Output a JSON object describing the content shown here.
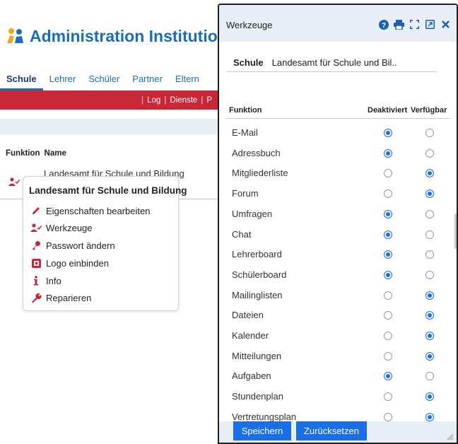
{
  "app": {
    "title": "Administration Institution"
  },
  "nav": {
    "tabs": [
      "Schule",
      "Lehrer",
      "Schüler",
      "Partner",
      "Eltern"
    ]
  },
  "subnav": {
    "items": [
      "Log",
      "Dienste",
      "P"
    ]
  },
  "table": {
    "headers": [
      "Funktion",
      "Name"
    ],
    "row_name": "Landesamt für Schule und Bildung"
  },
  "context_menu": {
    "title": "Landesamt für Schule und Bildung",
    "items": [
      {
        "label": "Eigenschaften bearbeiten",
        "icon": "pencil-icon"
      },
      {
        "label": "Werkzeuge",
        "icon": "user-check-icon"
      },
      {
        "label": "Passwort ändern",
        "icon": "key-icon"
      },
      {
        "label": "Logo einbinden",
        "icon": "image-icon"
      },
      {
        "label": "Info",
        "icon": "info-icon"
      },
      {
        "label": "Reparieren",
        "icon": "wrench-icon"
      }
    ]
  },
  "panel": {
    "title": "Werkzeuge",
    "header_icons": [
      "help-icon",
      "print-icon",
      "expand-icon",
      "external-link-icon",
      "close-icon"
    ],
    "school_label": "Schule",
    "school_value": "Landesamt für Schule und Bil..",
    "columns": [
      "Funktion",
      "Deaktiviert",
      "Verfügbar"
    ],
    "rows": [
      {
        "name": "E-Mail",
        "state": "deaktiviert"
      },
      {
        "name": "Adressbuch",
        "state": "deaktiviert"
      },
      {
        "name": "Mitgliederliste",
        "state": "verfuegbar"
      },
      {
        "name": "Forum",
        "state": "verfuegbar"
      },
      {
        "name": "Umfragen",
        "state": "deaktiviert"
      },
      {
        "name": "Chat",
        "state": "deaktiviert"
      },
      {
        "name": "Lehrerboard",
        "state": "deaktiviert"
      },
      {
        "name": "Schülerboard",
        "state": "deaktiviert"
      },
      {
        "name": "Mailinglisten",
        "state": "verfuegbar"
      },
      {
        "name": "Dateien",
        "state": "verfuegbar"
      },
      {
        "name": "Kalender",
        "state": "verfuegbar"
      },
      {
        "name": "Mitteilungen",
        "state": "verfuegbar"
      },
      {
        "name": "Aufgaben",
        "state": "deaktiviert"
      },
      {
        "name": "Stundenplan",
        "state": "verfuegbar"
      },
      {
        "name": "Vertretungsplan",
        "state": "verfuegbar"
      }
    ],
    "save_label": "Speichern",
    "reset_label": "Zurücksetzen"
  },
  "colors": {
    "brand_blue": "#1a6db8",
    "button_blue": "#1a6ee6",
    "menu_red": "#c82738",
    "header_bg": "#e8eef6"
  }
}
